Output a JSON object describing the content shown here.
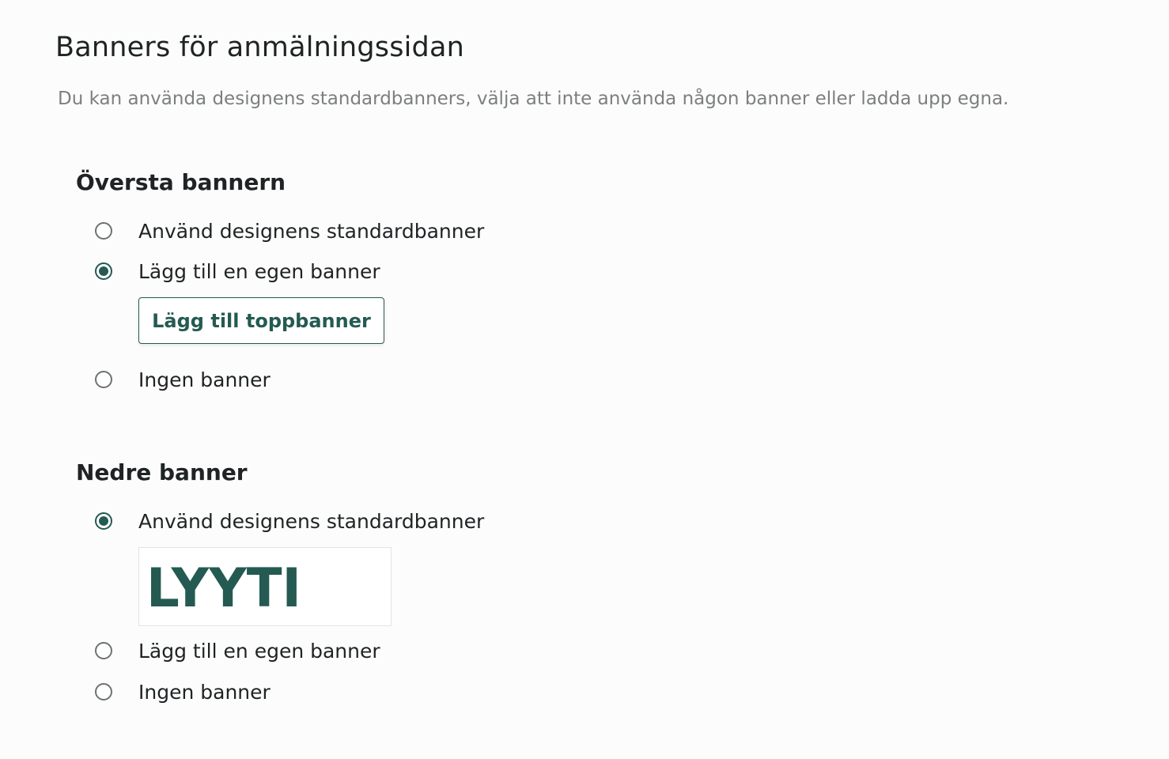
{
  "page": {
    "title": "Banners för anmälningssidan",
    "description": "Du kan använda designens standardbanners, välja att inte använda någon banner eller ladda upp egna."
  },
  "top_banner": {
    "title": "Översta bannern",
    "options": [
      {
        "label": "Använd designens standardbanner",
        "checked": false
      },
      {
        "label": "Lägg till en egen banner",
        "checked": true
      },
      {
        "label": "Ingen banner",
        "checked": false
      }
    ],
    "add_button_label": "Lägg till toppbanner"
  },
  "bottom_banner": {
    "title": "Nedre banner",
    "options": [
      {
        "label": "Använd designens standardbanner",
        "checked": true
      },
      {
        "label": "Lägg till en egen banner",
        "checked": false
      },
      {
        "label": "Ingen banner",
        "checked": false
      }
    ],
    "logo_text": "LYYTI"
  },
  "colors": {
    "accent": "#245a52",
    "text": "#1f2324",
    "muted": "#7c7f80",
    "background": "#fcfcfc"
  }
}
